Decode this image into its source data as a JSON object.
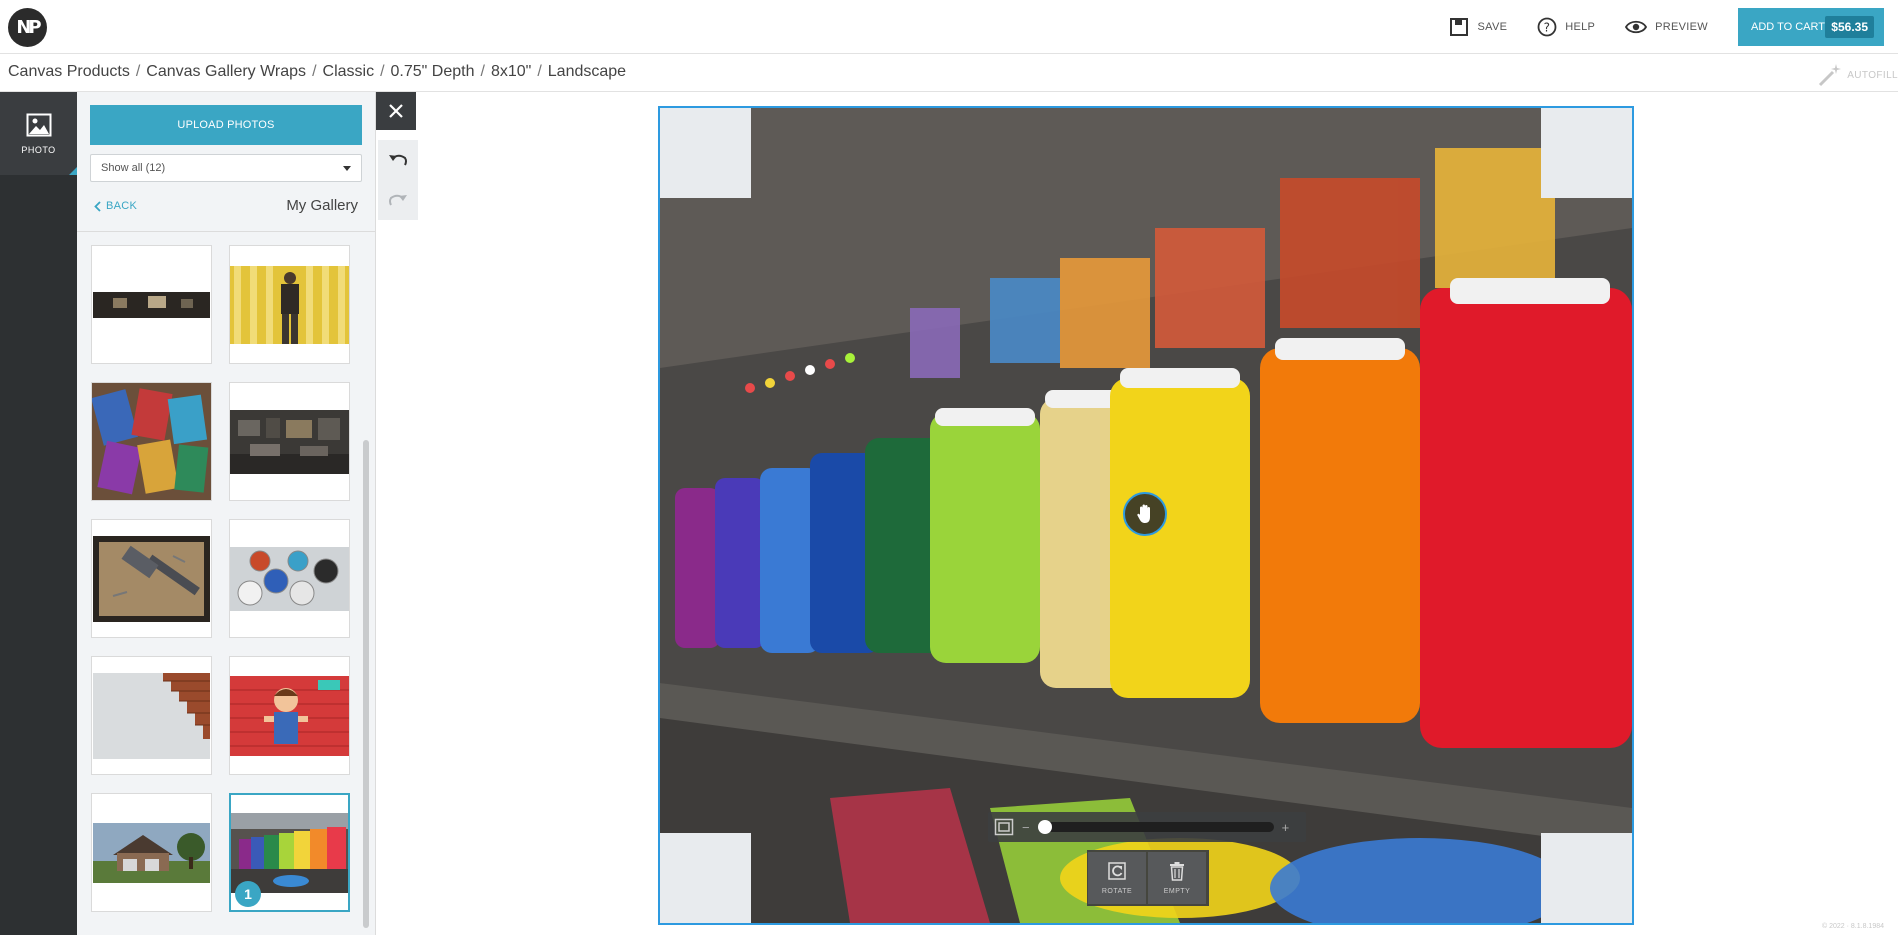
{
  "app": {
    "logo_text": "NP"
  },
  "topbar": {
    "save_label": "SAVE",
    "help_label": "HELP",
    "preview_label": "PREVIEW",
    "cart_label": "ADD TO CART",
    "cart_price": "$56.35",
    "accent_color": "#3aa6c4"
  },
  "breadcrumb": {
    "items": [
      "Canvas Products",
      "Canvas Gallery Wraps",
      "Classic",
      "0.75\" Depth",
      "8x10\"",
      "Landscape"
    ],
    "separator": "/"
  },
  "autofill": {
    "label": "AUTOFILL"
  },
  "rail": {
    "photo_label": "PHOTO"
  },
  "panel": {
    "upload_label": "UPLOAD PHOTOS",
    "filter_value": "Show all (12)",
    "back_label": "BACK",
    "gallery_title": "My Gallery",
    "thumbnails": [
      {
        "name": "dark-room-panorama",
        "subject": "dark room panorama"
      },
      {
        "name": "painter-yellow-stripes",
        "subject": "painter at yellow striped wall"
      },
      {
        "name": "paint-brushes",
        "subject": "colorful paint brushes"
      },
      {
        "name": "office-interior",
        "subject": "office interior"
      },
      {
        "name": "hammer-nails",
        "subject": "hammer and nails"
      },
      {
        "name": "paint-cans",
        "subject": "open paint cans"
      },
      {
        "name": "brick-wall",
        "subject": "grey wall with brick edge"
      },
      {
        "name": "cartoon-painter",
        "subject": "cartoon painter on red bricks"
      },
      {
        "name": "house-exterior",
        "subject": "house exterior"
      },
      {
        "name": "paint-jars-selected",
        "subject": "rainbow paint jars",
        "badge": "1",
        "selected": true
      }
    ]
  },
  "editor": {
    "rotate_label": "ROTATE",
    "empty_label": "EMPTY",
    "zoom_minus": "−",
    "zoom_plus": "+",
    "zoom_level": 0,
    "frame_color": "#2d9ae0"
  },
  "footer": {
    "copyright": "© 2022 · 8.1.8.1984"
  }
}
